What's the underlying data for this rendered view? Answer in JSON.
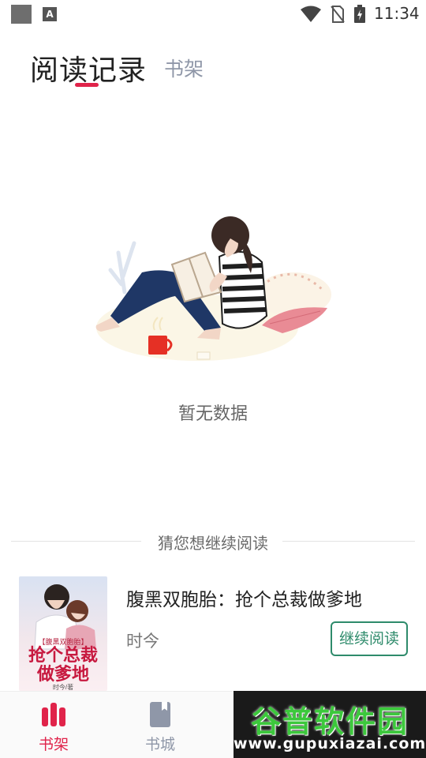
{
  "status_bar": {
    "time": "11:34",
    "notification_icon": "A",
    "icons": [
      "wifi-icon",
      "no-sim-icon",
      "battery-charging-icon"
    ]
  },
  "tabs": {
    "active": "阅读记录",
    "inactive": "书架"
  },
  "empty_state": {
    "message": "暂无数据",
    "illustration": "girl-reading-illustration"
  },
  "recommend": {
    "heading": "猜您想继续阅读",
    "book": {
      "title": "腹黑双胞胎：抢个总裁做爹地",
      "author": "时今",
      "action_label": "继续阅读",
      "cover": {
        "tag": "【腹黑双胞胎】",
        "title_line1": "抢个总裁",
        "title_line2": "做爹地",
        "author_credit": "时今/著"
      }
    }
  },
  "bottom_nav": {
    "items": [
      {
        "label": "书架",
        "icon": "bookshelf-icon",
        "active": true
      },
      {
        "label": "书城",
        "icon": "book-store-icon",
        "active": false
      }
    ]
  },
  "watermark": {
    "line1": "谷普软件园",
    "line2": "www.gupuxiazai.com"
  },
  "colors": {
    "accent": "#e0234a",
    "button_green": "#2e8b6b",
    "inactive_gray": "#8f97a8"
  }
}
